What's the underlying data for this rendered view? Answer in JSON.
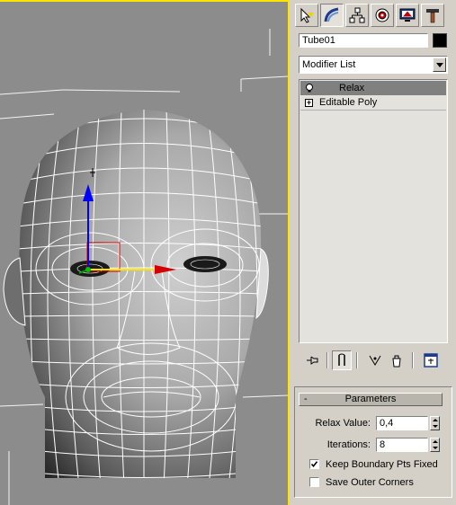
{
  "command_panel": {
    "tabs": [
      {
        "name": "create",
        "icon": "create-icon"
      },
      {
        "name": "modify",
        "icon": "modify-icon"
      },
      {
        "name": "hierarchy",
        "icon": "hierarchy-icon"
      },
      {
        "name": "motion",
        "icon": "motion-icon"
      },
      {
        "name": "display",
        "icon": "display-icon"
      },
      {
        "name": "utilities",
        "icon": "utilities-icon"
      }
    ],
    "active_tab": "modify",
    "object_name": "Tube01",
    "object_color": "#000000",
    "modifier_list_label": "Modifier List",
    "stack": [
      {
        "label": "Relax",
        "icon": "lightbulb-icon",
        "selected": true
      },
      {
        "label": "Editable Poly",
        "icon": "plus-box-icon",
        "selected": false
      }
    ],
    "stack_tools": [
      "pin-stack-icon",
      "show-end-result-icon",
      "make-unique-icon",
      "remove-modifier-icon",
      "configure-modifier-sets-icon"
    ]
  },
  "parameters": {
    "title": "Parameters",
    "collapse_symbol": "-",
    "relax_value_label": "Relax Value:",
    "relax_value": "0,4",
    "iterations_label": "Iterations:",
    "iterations": "8",
    "keep_boundary_label": "Keep Boundary Pts Fixed",
    "keep_boundary_checked": true,
    "save_outer_label": "Save Outer Corners",
    "save_outer_checked": false
  },
  "viewport": {
    "content": "wireframe-head-mesh",
    "active_border_color": "#ffe400",
    "background_color": "#8c8c8c",
    "gizmo_axes": [
      "x",
      "y",
      "z"
    ]
  }
}
